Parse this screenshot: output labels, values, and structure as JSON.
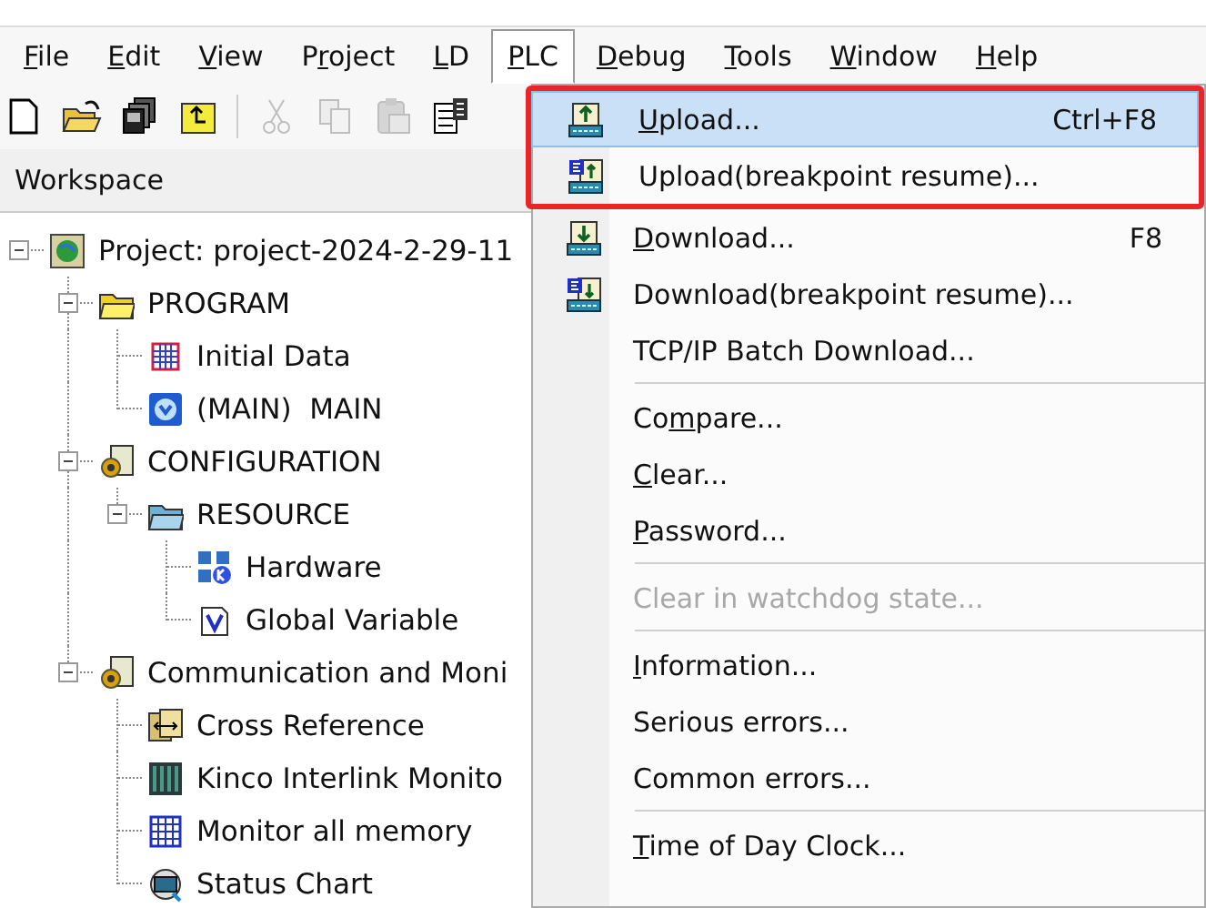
{
  "menubar": [
    {
      "key": "F",
      "rest": "ile",
      "selected": false
    },
    {
      "key": "E",
      "rest": "dit",
      "selected": false
    },
    {
      "key": "V",
      "rest": "iew",
      "selected": false
    },
    {
      "lead": "P",
      "key": "r",
      "rest": "oject",
      "selected": false
    },
    {
      "key": "L",
      "rest": "D",
      "selected": false
    },
    {
      "key": "P",
      "rest": "LC",
      "selected": true
    },
    {
      "key": "D",
      "rest": "ebug",
      "selected": false
    },
    {
      "key": "T",
      "rest": "ools",
      "selected": false
    },
    {
      "key": "W",
      "rest": "indow",
      "selected": false
    },
    {
      "key": "H",
      "rest": "elp",
      "selected": false
    }
  ],
  "toolbar": [
    {
      "kind": "new",
      "disabled": false
    },
    {
      "kind": "open",
      "disabled": false
    },
    {
      "kind": "stack",
      "disabled": false
    },
    {
      "kind": "folder-up",
      "disabled": false
    },
    {
      "kind": "separator"
    },
    {
      "kind": "cut",
      "disabled": true
    },
    {
      "kind": "copy",
      "disabled": true
    },
    {
      "kind": "paste",
      "disabled": true
    },
    {
      "kind": "table-doc",
      "disabled": false
    }
  ],
  "workspace": {
    "title": "Workspace",
    "tree": [
      {
        "kind": "project",
        "label": "Project: project-2024-2-29-11",
        "expanded": true,
        "children": [
          {
            "kind": "folder",
            "label": "PROGRAM",
            "expanded": true,
            "children": [
              {
                "kind": "grid",
                "label": "Initial Data"
              },
              {
                "kind": "program",
                "label": "(MAIN)  MAIN"
              }
            ]
          },
          {
            "kind": "config",
            "label": "CONFIGURATION",
            "expanded": true,
            "children": [
              {
                "kind": "resource",
                "label": "RESOURCE",
                "expanded": true,
                "children": [
                  {
                    "kind": "hardware",
                    "label": "Hardware"
                  },
                  {
                    "kind": "variable",
                    "label": "Global Variable"
                  }
                ]
              }
            ]
          },
          {
            "kind": "config",
            "label": "Communication and Moni",
            "expanded": true,
            "children": [
              {
                "kind": "crossref",
                "label": "Cross Reference"
              },
              {
                "kind": "columns",
                "label": "Kinco Interlink Monito"
              },
              {
                "kind": "memory",
                "label": "Monitor all memory"
              },
              {
                "kind": "status",
                "label": "Status Chart"
              }
            ]
          }
        ]
      }
    ]
  },
  "plc_menu": {
    "sections": [
      {
        "boxed": true,
        "separator_before": false,
        "items": [
          {
            "kind": "upload",
            "key": "U",
            "rest": "pload...",
            "shortcut": "Ctrl+F8",
            "selected": true,
            "disabled": false
          },
          {
            "kind": "upload-resume",
            "label": "Upload(breakpoint resume)...",
            "selected": false,
            "disabled": false
          }
        ]
      },
      {
        "boxed": false,
        "separator_before": false,
        "items": [
          {
            "kind": "download",
            "key": "D",
            "rest": "ownload...",
            "shortcut": "F8",
            "selected": false,
            "disabled": false
          },
          {
            "kind": "download-resume",
            "label": "Download(breakpoint resume)...",
            "selected": false,
            "disabled": false
          },
          {
            "kind": "plain",
            "label": "TCP/IP Batch Download...",
            "selected": false,
            "disabled": false
          }
        ]
      },
      {
        "boxed": false,
        "separator_before": true,
        "items": [
          {
            "kind": "plain",
            "lead": "Co",
            "key": "m",
            "rest": "pare...",
            "selected": false,
            "disabled": false
          },
          {
            "kind": "plain",
            "key": "C",
            "rest": "lear...",
            "selected": false,
            "disabled": false
          },
          {
            "kind": "plain",
            "key": "P",
            "rest": "assword...",
            "selected": false,
            "disabled": false
          }
        ]
      },
      {
        "boxed": false,
        "separator_before": true,
        "items": [
          {
            "kind": "plain",
            "label": "Clear in watchdog state...",
            "selected": false,
            "disabled": true
          }
        ]
      },
      {
        "boxed": false,
        "separator_before": true,
        "items": [
          {
            "kind": "plain",
            "key": "I",
            "rest": "nformation...",
            "selected": false,
            "disabled": false
          },
          {
            "kind": "plain",
            "label": "Serious errors...",
            "selected": false,
            "disabled": false
          },
          {
            "kind": "plain",
            "label": "Common errors...",
            "selected": false,
            "disabled": false
          }
        ]
      },
      {
        "boxed": false,
        "separator_before": true,
        "items": [
          {
            "kind": "plain",
            "key": "T",
            "rest": "ime of Day Clock...",
            "selected": false,
            "disabled": false
          }
        ]
      }
    ]
  }
}
